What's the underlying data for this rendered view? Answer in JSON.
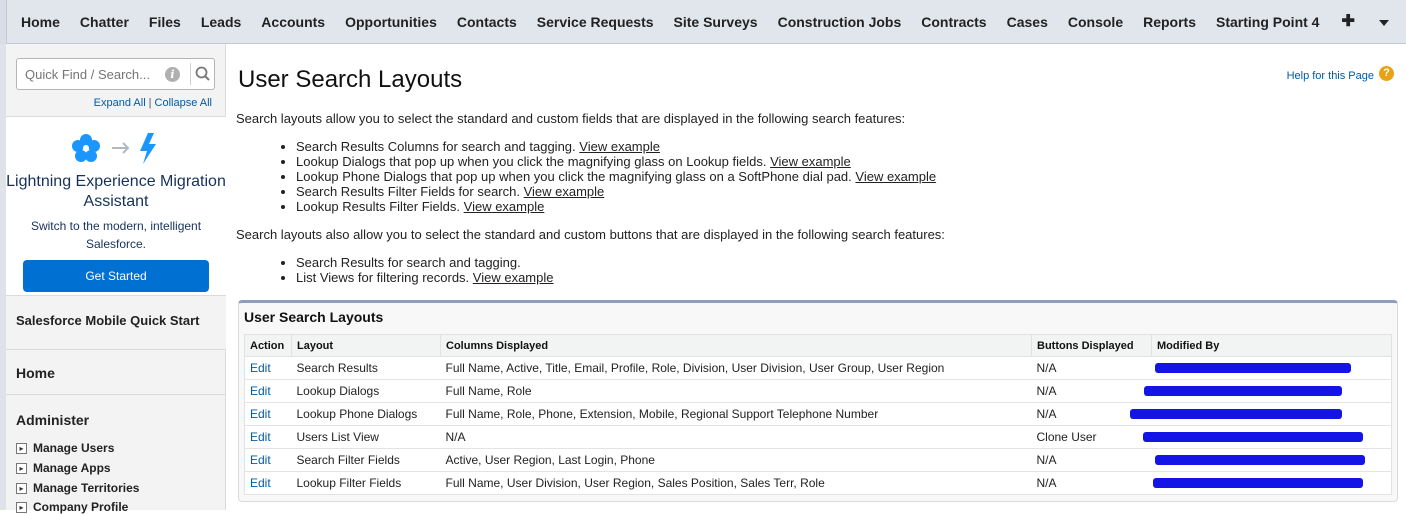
{
  "nav": {
    "tabs": [
      "Home",
      "Chatter",
      "Files",
      "Leads",
      "Accounts",
      "Opportunities",
      "Contacts",
      "Service Requests",
      "Site Surveys",
      "Construction Jobs",
      "Contracts",
      "Cases",
      "Console",
      "Reports",
      "Starting Point 4"
    ],
    "add_icon": "plus-icon",
    "more_icon": "caret-down-icon"
  },
  "sidebar": {
    "search_placeholder": "Quick Find / Search...",
    "expand_all": "Expand All",
    "collapse_all": "Collapse All",
    "lex": {
      "title": "Lightning Experience Migration Assistant",
      "subtitle": "Switch to the modern, intelligent Salesforce.",
      "button": "Get Started"
    },
    "mobile_quick_start": "Salesforce Mobile Quick Start",
    "home": "Home",
    "administer": "Administer",
    "admin_items": [
      "Manage Users",
      "Manage Apps",
      "Manage Territories",
      "Company Profile"
    ]
  },
  "main": {
    "title": "User Search Layouts",
    "help": "Help for this Page",
    "intro1": "Search layouts allow you to select the standard and custom fields that are displayed in the following search features:",
    "features1": [
      {
        "text": "Search Results Columns for search and tagging.",
        "link": "View example"
      },
      {
        "text": "Lookup Dialogs that pop up when you click the magnifying glass on Lookup fields.",
        "link": "View example"
      },
      {
        "text": "Lookup Phone Dialogs that pop up when you click the magnifying glass on a SoftPhone dial pad.",
        "link": "View example"
      },
      {
        "text": "Search Results Filter Fields for search.",
        "link": "View example"
      },
      {
        "text": "Lookup Results Filter Fields.",
        "link": "View example"
      }
    ],
    "intro2": "Search layouts also allow you to select the standard and custom buttons that are displayed in the following search features:",
    "features2": [
      {
        "text": "Search Results for search and tagging.",
        "link": ""
      },
      {
        "text": "List Views for filtering records.",
        "link": "View example"
      }
    ],
    "table": {
      "title": "User Search Layouts",
      "headers": [
        "Action",
        "Layout",
        "Columns Displayed",
        "Buttons Displayed",
        "Modified By"
      ],
      "rows": [
        {
          "action": "Edit",
          "layout": "Search Results",
          "columns": "Full Name, Active, Title, Email, Profile, Role, Division, User Division, User Group, User Region",
          "buttons": "N/A"
        },
        {
          "action": "Edit",
          "layout": "Lookup Dialogs",
          "columns": "Full Name, Role",
          "buttons": "N/A"
        },
        {
          "action": "Edit",
          "layout": "Lookup Phone Dialogs",
          "columns": "Full Name, Role, Phone, Extension, Mobile, Regional Support Telephone Number",
          "buttons": "N/A"
        },
        {
          "action": "Edit",
          "layout": "Users List View",
          "columns": "N/A",
          "buttons": "Clone User"
        },
        {
          "action": "Edit",
          "layout": "Search Filter Fields",
          "columns": "Active, User Region, Last Login, Phone",
          "buttons": "N/A"
        },
        {
          "action": "Edit",
          "layout": "Lookup Filter Fields",
          "columns": "Full Name, User Division, User Region, Sales Position, Sales Terr, Role",
          "buttons": "N/A"
        }
      ]
    }
  },
  "colors": {
    "link": "#015ba7",
    "button": "#0070d2",
    "redaction": "#1414e6",
    "help_icon": "#e8a212"
  }
}
